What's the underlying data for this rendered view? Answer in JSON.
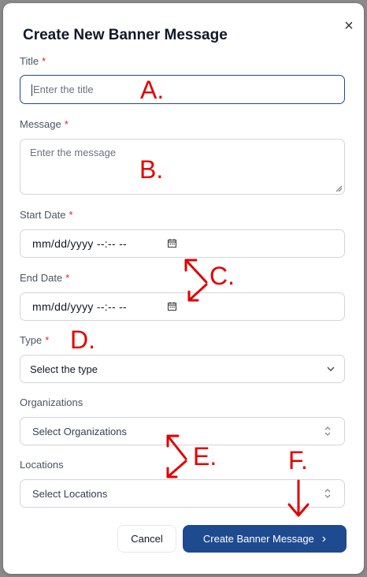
{
  "dialog": {
    "title": "Create New Banner Message",
    "close_glyph": "×"
  },
  "form": {
    "title": {
      "label": "Title",
      "required_mark": "*",
      "placeholder": "Enter the title"
    },
    "message": {
      "label": "Message",
      "required_mark": "*",
      "placeholder": "Enter the message"
    },
    "start_date": {
      "label": "Start Date",
      "required_mark": "*",
      "value": "mm/dd/yyyy --:-- --"
    },
    "end_date": {
      "label": "End Date",
      "required_mark": "*",
      "value": "mm/dd/yyyy --:-- --"
    },
    "type": {
      "label": "Type",
      "required_mark": "*",
      "value": "Select the type"
    },
    "organizations": {
      "label": "Organizations",
      "value": "Select Organizations"
    },
    "locations": {
      "label": "Locations",
      "value": "Select Locations"
    }
  },
  "buttons": {
    "cancel": "Cancel",
    "create": "Create Banner Message",
    "create_chevron": "›"
  },
  "annotations": {
    "a": "A.",
    "b": "B.",
    "c": "C.",
    "d": "D.",
    "e": "E.",
    "f": "F."
  },
  "colors": {
    "primary": "#1e4b8f",
    "required": "#dc2626",
    "annotation": "#e30000"
  },
  "icons": [
    "close-icon",
    "calendar-icon",
    "chevron-down-icon",
    "up-down-chevron-icon",
    "chevron-right-icon",
    "resize-handle-icon"
  ]
}
